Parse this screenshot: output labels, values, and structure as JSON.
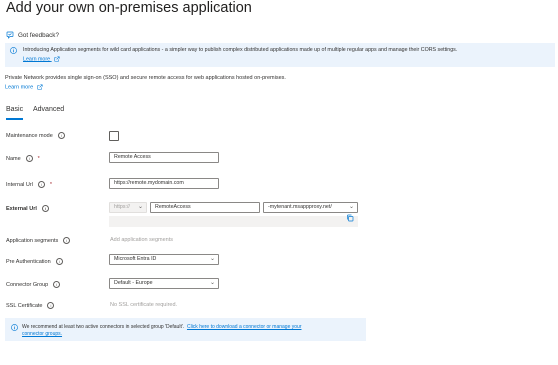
{
  "header": {
    "title": "Add your own on-premises application",
    "more": "···"
  },
  "feedback": {
    "label": "Got feedback?"
  },
  "banner": {
    "text": "Introducing Application segments for wild card applications - a simpler way to publish complex distributed applications made up of multiple regular apps and manage their CORS settings.",
    "link": "Learn more"
  },
  "description": {
    "text": "Private Network provides single sign-on (SSO) and secure remote access for web applications hosted on-premises.",
    "link": "Learn more"
  },
  "tabs": [
    {
      "label": "Basic",
      "selected": true
    },
    {
      "label": "Advanced",
      "selected": false
    }
  ],
  "form": {
    "maintenance_mode": {
      "label": "Maintenance mode",
      "checked": false
    },
    "name": {
      "label": "Name",
      "required": "*",
      "value": "Remote Access"
    },
    "internal_url": {
      "label": "Internal Url",
      "required": "*",
      "value": "https://remote.mydomain.com"
    },
    "external_url": {
      "label": "External Url",
      "protocol": "https://",
      "subdomain": "RemoteAccess",
      "domain": "-mytenant.msappproxy.net/"
    },
    "application_segments": {
      "label": "Application segments",
      "value": "Add application segments"
    },
    "pre_authentication": {
      "label": "Pre Authentication",
      "value": "Microsoft Entra ID"
    },
    "connector_group": {
      "label": "Connector Group",
      "value": "Default - Europe"
    },
    "ssl_certificate": {
      "label": "SSL Certificate",
      "value": "No SSL certificate required."
    }
  },
  "notice": {
    "text": "We recommend at least two active connectors in selected group 'Default'.",
    "link_line1": "Click here to download a connector or manage your",
    "link_line2": "connector groups."
  },
  "colors": {
    "accent": "#0078d4",
    "info_bg": "#ebf3fc",
    "required": "#a4262c"
  }
}
